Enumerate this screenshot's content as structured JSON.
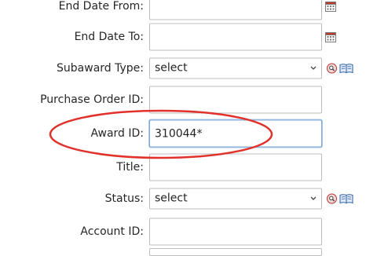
{
  "form": {
    "end_date_from": {
      "label": "End Date From:",
      "value": ""
    },
    "end_date_to": {
      "label": "End Date To:",
      "value": ""
    },
    "subaward_type": {
      "label": "Subaward Type:",
      "selected": "select"
    },
    "purchase_order_id": {
      "label": "Purchase Order ID:",
      "value": ""
    },
    "award_id": {
      "label": "Award ID:",
      "value": "310044*"
    },
    "title": {
      "label": "Title:",
      "value": ""
    },
    "status": {
      "label": "Status:",
      "selected": "select"
    },
    "account_id": {
      "label": "Account ID:",
      "value": ""
    }
  },
  "icons": {
    "calendar": "calendar-icon",
    "lookup": "magnifier-lookup-icon",
    "help": "book-help-icon"
  },
  "colors": {
    "annotation_oval": "#e0312b",
    "focus_border": "#7fa9d6",
    "field_border": "#bdbdbd"
  }
}
